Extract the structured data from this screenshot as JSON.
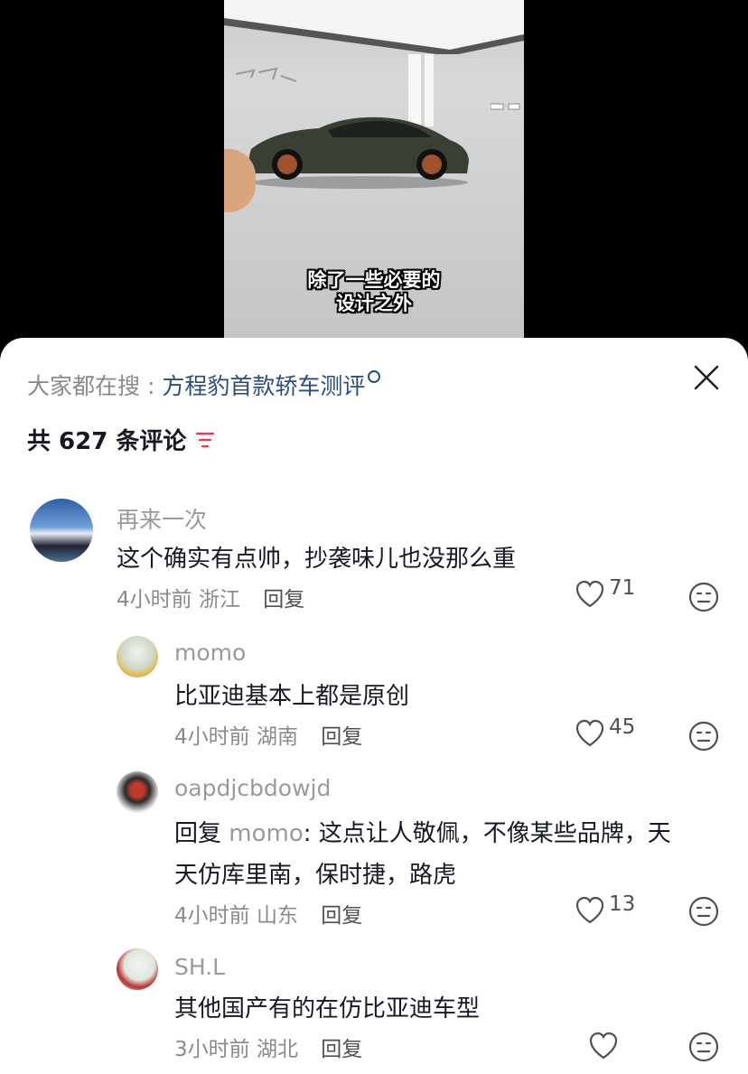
{
  "video": {
    "subtitle_line1": "除了一些必要的",
    "subtitle_line2": "设计之外"
  },
  "search": {
    "prefix": "大家都在搜 : ",
    "keyword": "方程豹首款轿车测评"
  },
  "comments_header": {
    "count_text": "共 627 条评论"
  },
  "comments": [
    {
      "name": "再来一次",
      "text": "这个确实有点帅，抄袭味儿也没那么重",
      "time": "4小时前",
      "location": "浙江",
      "reply_label": "回复",
      "likes": "71"
    },
    {
      "name": "momo",
      "text": "比亚迪基本上都是原创",
      "time": "4小时前",
      "location": "湖南",
      "reply_label": "回复",
      "likes": "45"
    },
    {
      "name": "oapdjcbdowjd",
      "reply_prefix": "回复 ",
      "reply_target": "momo",
      "text_line1": ": 这点让人敬佩，不像某些品牌，天",
      "text_line2": "天仿库里南，保时捷，路虎",
      "time": "4小时前",
      "location": "山东",
      "reply_label": "回复",
      "likes": "13"
    },
    {
      "name": "SH.L",
      "text": "其他国产有的在仿比亚迪车型",
      "time": "3小时前",
      "location": "湖北",
      "reply_label": "回复",
      "likes": ""
    }
  ],
  "colors": {
    "accent": "#fe2c55",
    "link": "#2b4c7e",
    "muted": "#9a9a9a"
  }
}
